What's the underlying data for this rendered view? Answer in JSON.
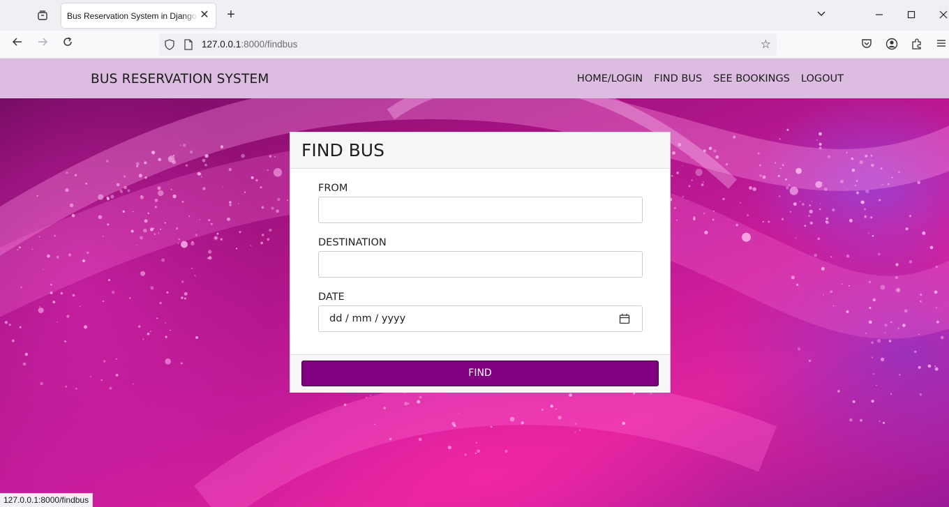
{
  "browser": {
    "tab_title": "Bus Reservation System in Django P",
    "tab_close": "✕",
    "new_tab": "+",
    "url_host": "127.0.0.1",
    "url_rest": ":8000/findbus",
    "status_url": "127.0.0.1:8000/findbus"
  },
  "site": {
    "brand": "BUS RESERVATION SYSTEM",
    "nav": [
      "HOME/LOGIN",
      "FIND BUS",
      "SEE BOOKINGS",
      "LOGOUT"
    ]
  },
  "form": {
    "title": "FIND BUS",
    "from_label": "FROM",
    "from_value": "",
    "destination_label": "DESTINATION",
    "destination_value": "",
    "date_label": "DATE",
    "date_placeholder": "dd / mm / yyyy",
    "submit_label": "FIND"
  },
  "colors": {
    "header_bg": "#dcbde1",
    "button_bg": "#800080"
  }
}
